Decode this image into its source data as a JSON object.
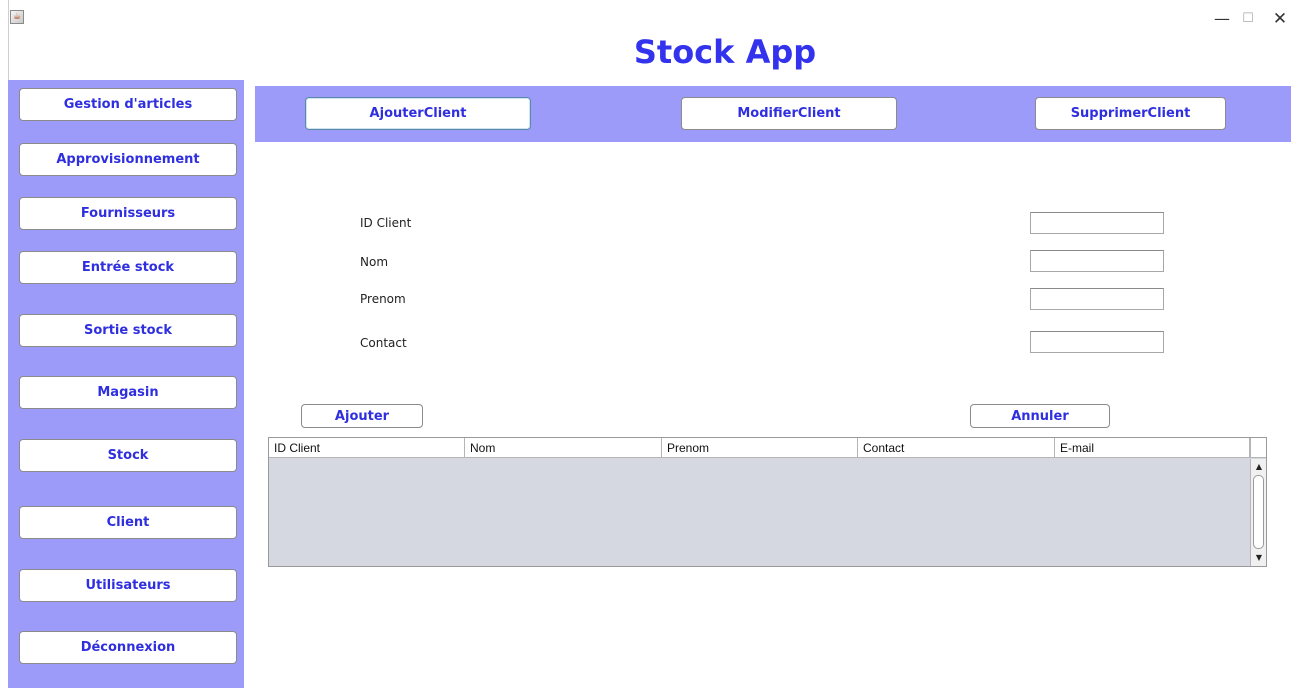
{
  "window": {
    "title": "Stock App",
    "controls": {
      "minimize": "—",
      "maximize": "☐",
      "close": "✕"
    }
  },
  "sidebar": {
    "items": [
      {
        "label": "Gestion d'articles"
      },
      {
        "label": "Approvisionnement"
      },
      {
        "label": "Fournisseurs"
      },
      {
        "label": "Entrée stock"
      },
      {
        "label": "Sortie stock"
      },
      {
        "label": "Magasin"
      },
      {
        "label": "Stock"
      },
      {
        "label": "Client"
      },
      {
        "label": "Utilisateurs"
      },
      {
        "label": "Déconnexion"
      }
    ]
  },
  "topbar": {
    "add_client": "AjouterClient",
    "modify_client": "ModifierClient",
    "delete_client": "SupprimerClient"
  },
  "form": {
    "id_label": "ID  Client",
    "nom_label": "Nom",
    "prenom_label": "Prenom",
    "contact_label": "Contact",
    "id_value": "",
    "nom_value": "",
    "prenom_value": "",
    "contact_value": ""
  },
  "actions": {
    "add": "Ajouter",
    "cancel": "Annuler"
  },
  "table": {
    "columns": [
      "ID Client",
      "Nom",
      "Prenom",
      "Contact",
      "E-mail"
    ],
    "rows": []
  },
  "colors": {
    "accent": "#9d9bf9",
    "button_text": "#2f2fe0",
    "title": "#3333ee",
    "table_bg": "#d5d8e0"
  }
}
